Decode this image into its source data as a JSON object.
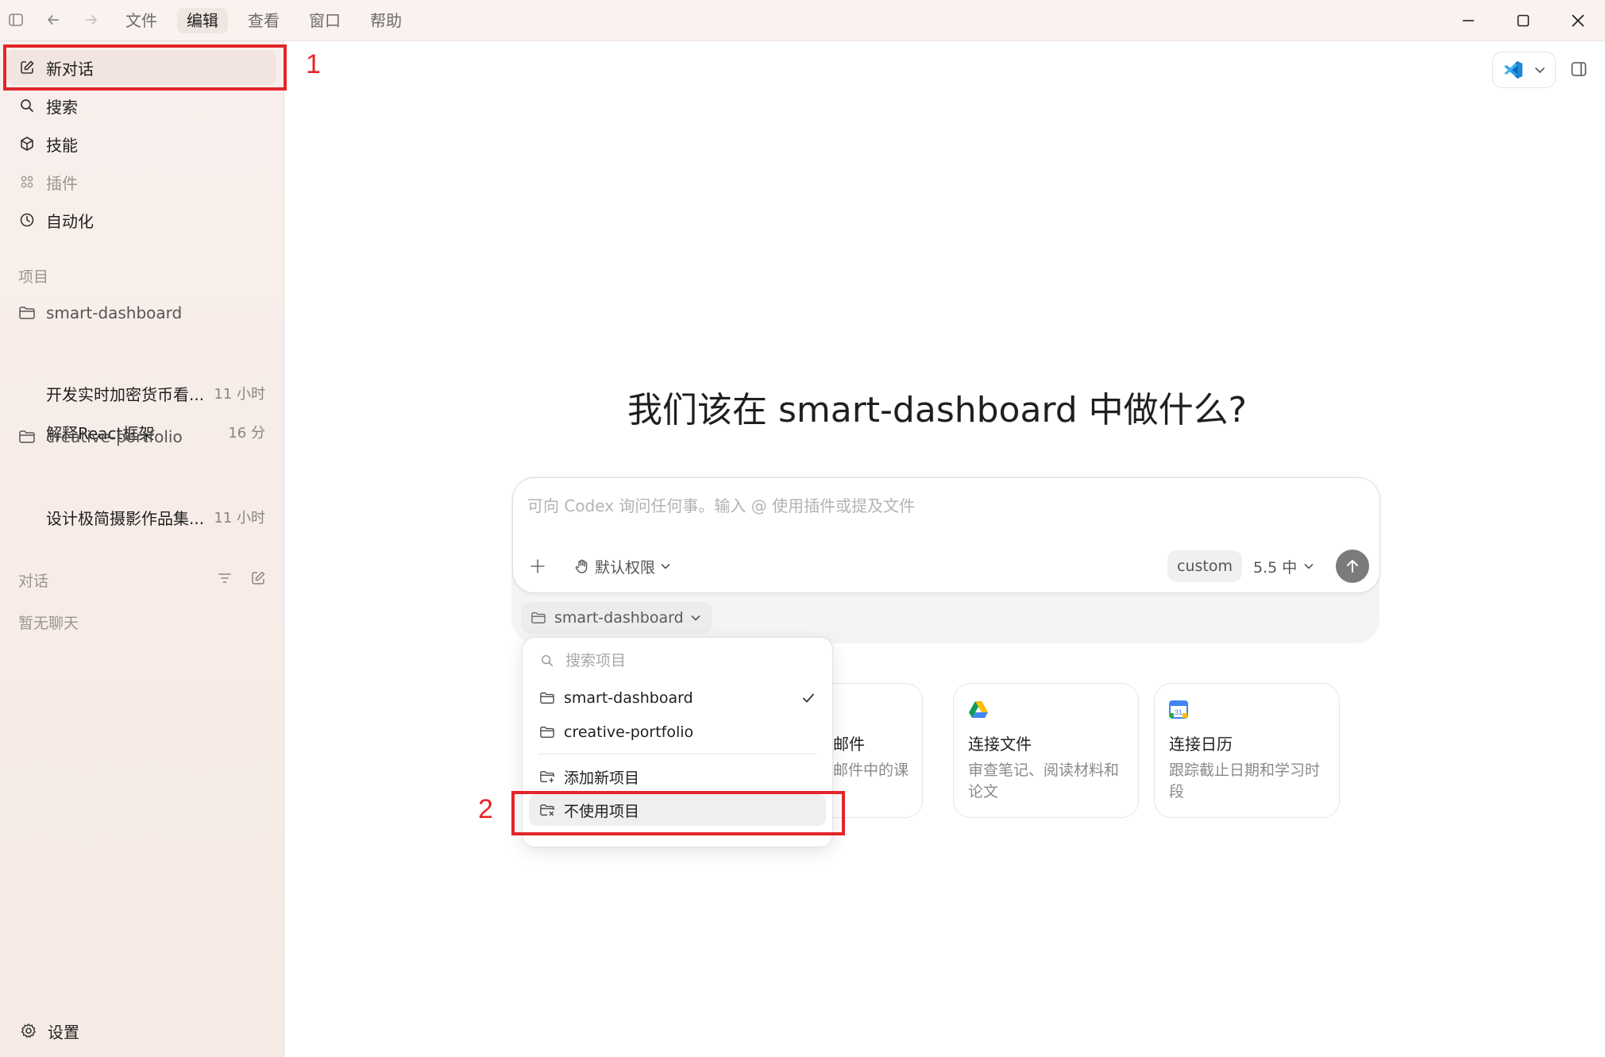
{
  "menubar": {
    "items": [
      "文件",
      "编辑",
      "查看",
      "窗口",
      "帮助"
    ],
    "active_index": 1
  },
  "sidebar": {
    "new_chat": "新对话",
    "search": "搜索",
    "skills": "技能",
    "plugins": "插件",
    "automation": "自动化",
    "projects_title": "项目",
    "projects": [
      {
        "name": "smart-dashboard",
        "threads": [
          {
            "title": "开发实时加密货币看...",
            "time": "11 小时"
          },
          {
            "title": "解释React框架",
            "time": "16 分"
          }
        ]
      },
      {
        "name": "creative-portfolio",
        "threads": [
          {
            "title": "设计极简摄影作品集...",
            "time": "11 小时"
          }
        ]
      }
    ],
    "chats_title": "对话",
    "no_chats": "暂无聊天",
    "settings": "设置"
  },
  "main": {
    "heading": "我们该在 smart-dashboard 中做什么?",
    "composer": {
      "placeholder": "可向 Codex 询问任何事。输入 @ 使用插件或提及文件",
      "permission_label": "默认权限",
      "custom_label": "custom",
      "model_label": "5.5 中"
    },
    "project_chip": "smart-dashboard",
    "dropdown": {
      "search_placeholder": "搜索项目",
      "projects": [
        "smart-dashboard",
        "creative-portfolio"
      ],
      "selected": "smart-dashboard",
      "add_project": "添加新项目",
      "no_project": "不使用项目"
    },
    "cards": [
      {
        "title": "邮件",
        "desc": "邮件中的课"
      },
      {
        "title": "连接文件",
        "desc": "审查笔记、阅读材料和论文"
      },
      {
        "title": "连接日历",
        "desc": "跟踪截止日期和学习时段"
      }
    ]
  },
  "annotations": {
    "one": "1",
    "two": "2"
  },
  "colors": {
    "annotation": "#e3262b",
    "sidebar_bg": "#f8efec",
    "send_button": "#7b7b7b"
  }
}
